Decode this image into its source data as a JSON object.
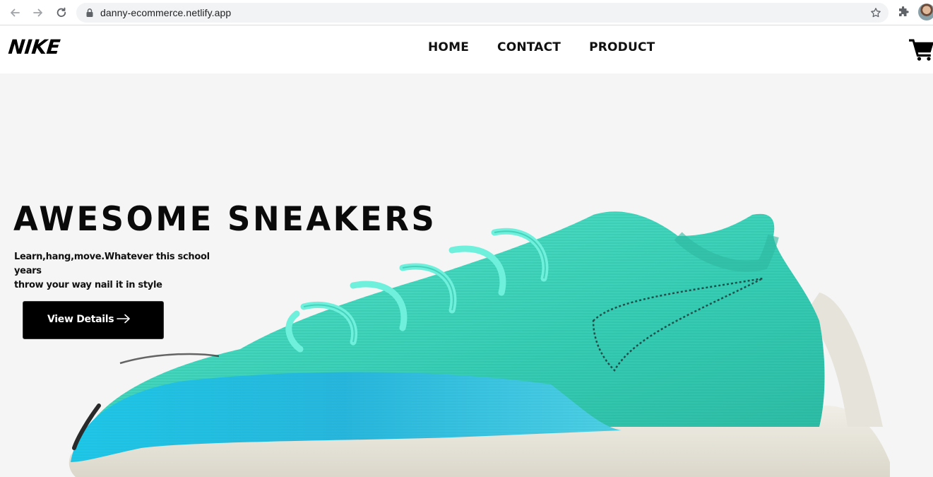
{
  "browser": {
    "url": "danny-ecommerce.netlify.app",
    "icons": [
      "back-icon",
      "forward-icon",
      "reload-icon",
      "lock-icon",
      "star-icon",
      "extensions-icon",
      "profile-avatar"
    ]
  },
  "header": {
    "logo": "NIKE",
    "nav": [
      {
        "label": "HOME"
      },
      {
        "label": "CONTACT"
      },
      {
        "label": "PRODUCT"
      }
    ],
    "cart_icon": "cart-icon"
  },
  "hero": {
    "title": "AWESOME SNEAKERS",
    "subtitle_line1": "Learn,hang,move.Whatever this school years",
    "subtitle_line2": "throw your way nail it in style",
    "cta_label": "View Details",
    "cta_icon": "arrow-right-icon",
    "image": "sneaker-image"
  },
  "colors": {
    "hero_bg": "#f5f5f5",
    "button_bg": "#000000",
    "shoe_upper": "#3fd6bd",
    "shoe_midfoot": "#27b9dc",
    "shoe_sole": "#e9e6dc"
  }
}
